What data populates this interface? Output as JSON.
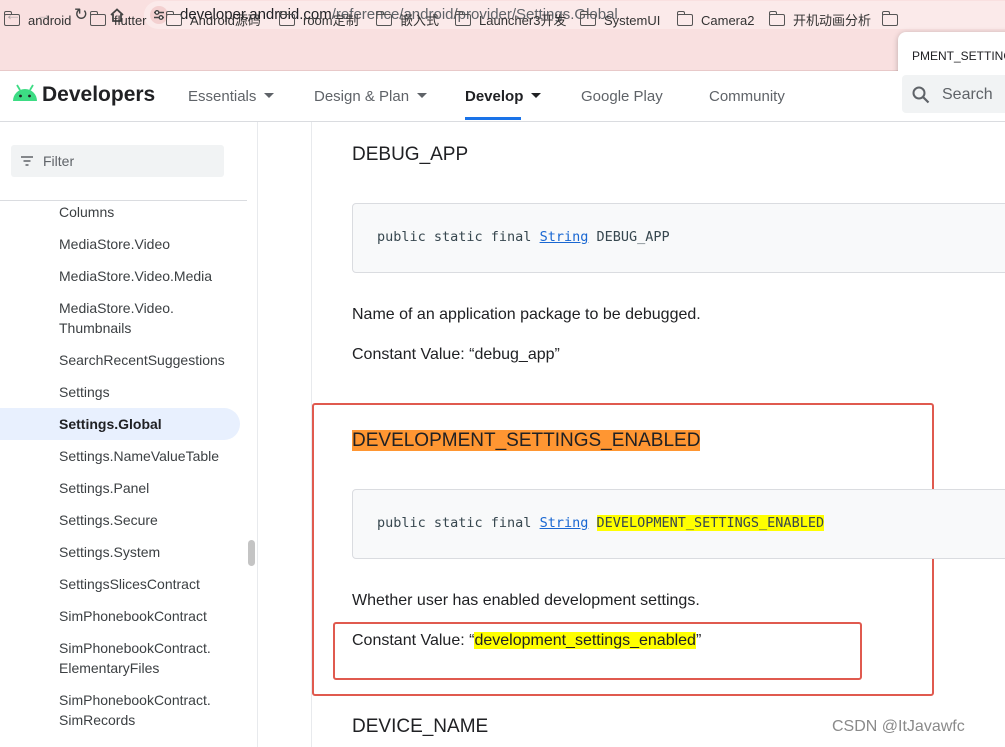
{
  "browser": {
    "url_host": "developer.android.com",
    "url_path": "/reference/android/provider/Settings.Global",
    "bookmarks": [
      "android",
      "flutter",
      "Android源码",
      "room定制",
      "嵌入式",
      "Launcher3开发",
      "SystemUI",
      "Camera2",
      "开机动画分析"
    ],
    "popup_text": "PMENT_SETTINGS",
    "icons": [
      "back-arrow-icon",
      "forward-arrow-icon",
      "reload-icon",
      "home-icon",
      "site-info-icon",
      "folder-icon"
    ]
  },
  "header": {
    "logo_text": "Developers",
    "tabs": [
      {
        "label": "Essentials",
        "dropdown": true
      },
      {
        "label": "Design & Plan",
        "dropdown": true
      },
      {
        "label": "Develop",
        "dropdown": true,
        "active": true
      },
      {
        "label": "Google Play",
        "dropdown": false
      },
      {
        "label": "Community",
        "dropdown": false
      }
    ],
    "search_label": "Search",
    "accent_color": "#1a73e8"
  },
  "sidebar": {
    "filter_placeholder": "Filter",
    "items": [
      {
        "label": "Columns"
      },
      {
        "label": "MediaStore.Video"
      },
      {
        "label": "MediaStore.Video.Media"
      },
      {
        "label": "MediaStore.Video.",
        "label2": "Thumbnails"
      },
      {
        "label": "SearchRecentSuggestions"
      },
      {
        "label": "Settings"
      },
      {
        "label": "Settings.Global",
        "active": true
      },
      {
        "label": "Settings.NameValueTable"
      },
      {
        "label": "Settings.Panel"
      },
      {
        "label": "Settings.Secure"
      },
      {
        "label": "Settings.System"
      },
      {
        "label": "SettingsSlicesContract"
      },
      {
        "label": "SimPhonebookContract"
      },
      {
        "label": "SimPhonebookContract.",
        "label2": "ElementaryFiles"
      },
      {
        "label": "SimPhonebookContract.",
        "label2": "SimRecords"
      }
    ]
  },
  "main": {
    "sections": [
      {
        "title": "DEBUG_APP",
        "code_prefix": "public static final",
        "code_type": "String",
        "code_name": "DEBUG_APP",
        "description": "Name of an application package to be debugged.",
        "constant_label": "Constant Value: “",
        "constant_value": "debug_app",
        "constant_suffix": "”"
      },
      {
        "title": "DEVELOPMENT_SETTINGS_ENABLED",
        "code_prefix": "public static final",
        "code_type": "String",
        "code_name": "DEVELOPMENT_SETTINGS_ENABLED",
        "description": "Whether user has enabled development settings.",
        "constant_label": "Constant Value: “",
        "constant_value": "development_settings_enabled",
        "constant_suffix": "”"
      },
      {
        "title": "DEVICE_NAME"
      }
    ],
    "highlight_colors": {
      "title": "#ff9632",
      "match": "#ffff00",
      "annotation_box": "#e05a4f"
    }
  },
  "watermark": "CSDN @ItJavawfc"
}
